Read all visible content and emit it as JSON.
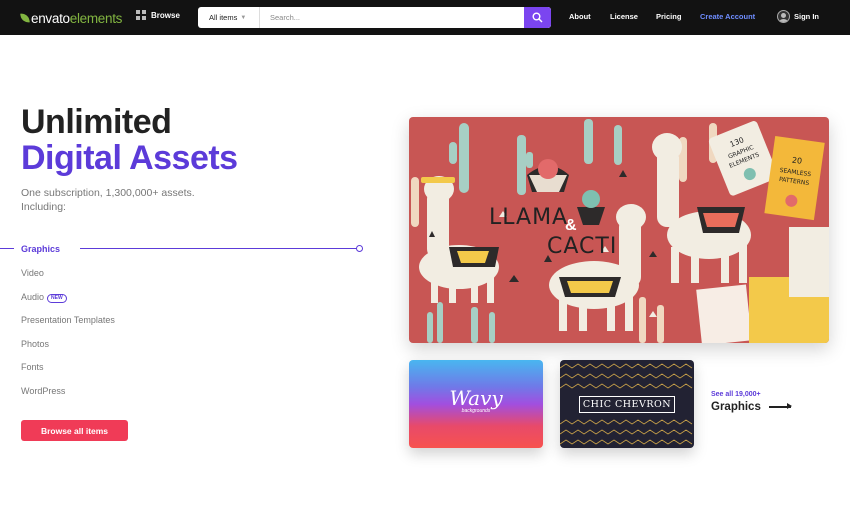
{
  "header": {
    "logo_text_1": "envato",
    "logo_text_2": "elements",
    "browse_label": "Browse",
    "search_category": "All items",
    "search_placeholder": "Search...",
    "nav": [
      "About",
      "License",
      "Pricing",
      "Create Account",
      "Sign In"
    ]
  },
  "hero": {
    "headline_1": "Unlimited",
    "headline_2": "Digital Assets",
    "subtitle_1": "One subscription, 1,300,000+ assets.",
    "subtitle_2": "Including:",
    "categories": [
      "Graphics",
      "Video",
      "Audio",
      "Presentation Templates",
      "Photos",
      "Fonts",
      "WordPress"
    ],
    "new_badge": "NEW",
    "cta_label": "Browse all items"
  },
  "showcase": {
    "main_title_1": "LLAMA",
    "main_amp": "&",
    "main_title_2": "CACTI",
    "tag_1": "130 GRAPHIC ELEMENTS",
    "tag_2": "20 SEAMLESS PATTERNS",
    "card1_title": "Wavy",
    "card1_sub": "backgrounds",
    "card2_title": "CHIC CHEVRON",
    "see_all": "See all 19,000+",
    "see_all_cat": "Graphics"
  },
  "colors": {
    "accent": "#5c3bd9",
    "cta": "#f03b57",
    "topbar": "#121212",
    "brand_green": "#82b541",
    "search_button": "#7b45f0",
    "hero_bg": "#c85654"
  }
}
